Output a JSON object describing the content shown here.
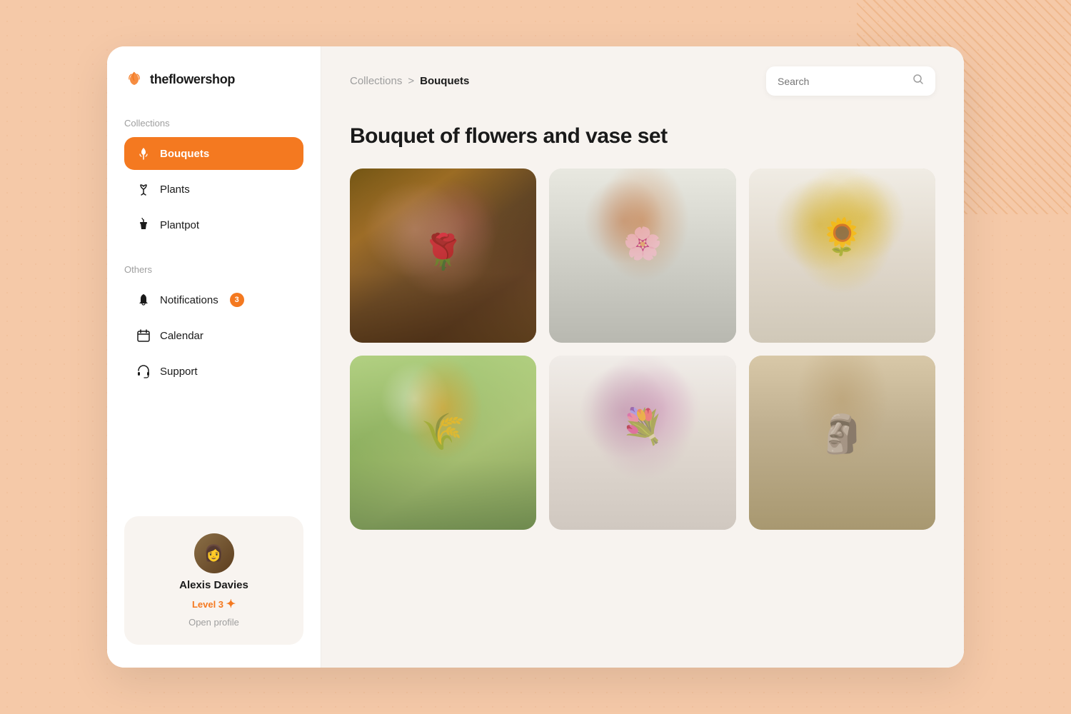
{
  "app": {
    "logo_text_bold": "the",
    "logo_text_light": "flowershop"
  },
  "sidebar": {
    "collections_label": "Collections",
    "others_label": "Others",
    "nav_items_collections": [
      {
        "id": "bouquets",
        "label": "Bouquets",
        "icon": "🌷",
        "active": true
      },
      {
        "id": "plants",
        "label": "Plants",
        "icon": "🌱",
        "active": false
      },
      {
        "id": "plantpot",
        "label": "Plantpot",
        "icon": "🪴",
        "active": false
      }
    ],
    "nav_items_others": [
      {
        "id": "notifications",
        "label": "Notifications",
        "icon": "🔔",
        "badge": "3",
        "active": false
      },
      {
        "id": "calendar",
        "label": "Calendar",
        "icon": "📅",
        "badge": null,
        "active": false
      },
      {
        "id": "support",
        "label": "Support",
        "icon": "🎧",
        "badge": null,
        "active": false
      }
    ],
    "profile": {
      "name": "Alexis Davies",
      "level": "Level 3",
      "link_text": "Open profile"
    }
  },
  "header": {
    "breadcrumb_parent": "Collections",
    "breadcrumb_separator": ">",
    "breadcrumb_current": "Bouquets",
    "search_placeholder": "Search"
  },
  "main": {
    "page_title": "Bouquet of flowers and vase set",
    "images": [
      {
        "id": "img1",
        "alt": "Roses in glass vase"
      },
      {
        "id": "img2",
        "alt": "Orange flowers in blue pitcher"
      },
      {
        "id": "img3",
        "alt": "Sunflowers in white vase"
      },
      {
        "id": "img4",
        "alt": "Wild flower arrangement"
      },
      {
        "id": "img5",
        "alt": "Pink roses bouquet"
      },
      {
        "id": "img6",
        "alt": "Stone sculpture with dried flowers"
      }
    ]
  }
}
